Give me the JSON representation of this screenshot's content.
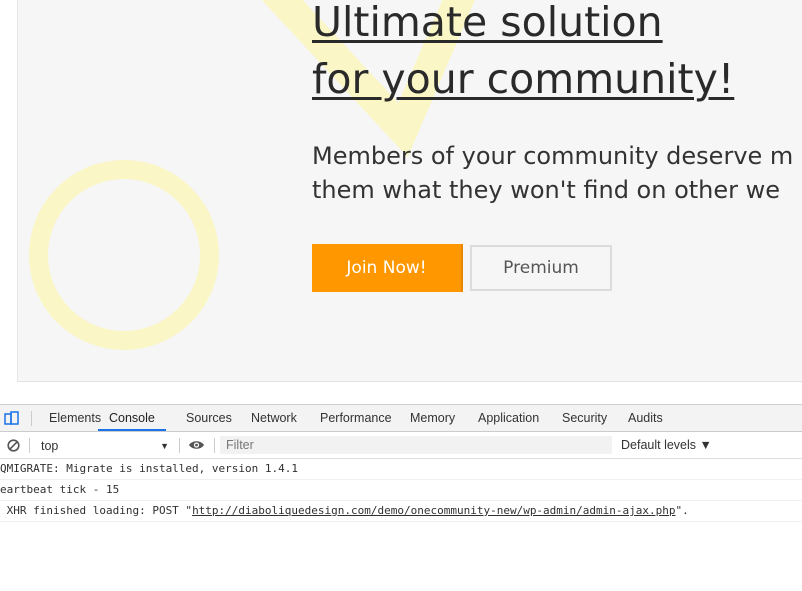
{
  "hero": {
    "title_line1": "Ultimate solution",
    "title_line2": "for your community!",
    "subtitle_line1": "Members of your community deserve m",
    "subtitle_line2": "them what they won't find on other we",
    "join_label": "Join Now!",
    "premium_label": "Premium",
    "colors": {
      "accent": "#ff9800",
      "decor": "#faf6c6"
    }
  },
  "devtools": {
    "inspect_icon": "device-toggle-icon",
    "tabs": [
      "Elements",
      "Console",
      "Sources",
      "Network",
      "Performance",
      "Memory",
      "Application",
      "Security",
      "Audits"
    ],
    "active_tab": "Console",
    "toolbar": {
      "context": "top",
      "filter_placeholder": "Filter",
      "levels": "Default levels ▼"
    },
    "console_lines": [
      {
        "text": "QMIGRATE: Migrate is installed, version 1.4.1"
      },
      {
        "text": "eartbeat tick - 15"
      },
      {
        "prefix": " XHR finished loading: POST \"",
        "link": "http://diaboliquedesign.com/demo/onecommunity-new/wp-admin/admin-ajax.php",
        "suffix": "\"."
      }
    ]
  }
}
